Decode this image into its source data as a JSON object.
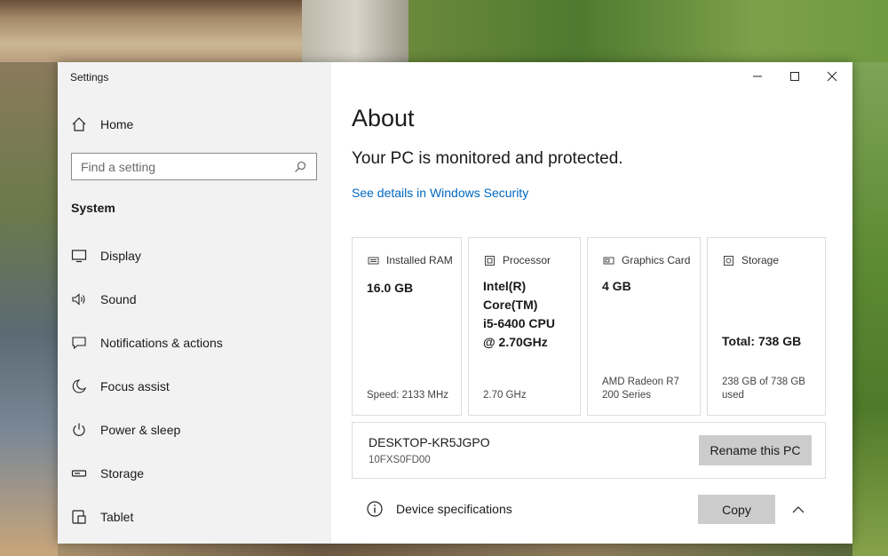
{
  "window": {
    "title": "Settings"
  },
  "sidebar": {
    "home_label": "Home",
    "search_placeholder": "Find a setting",
    "section_title": "System",
    "items": [
      {
        "label": "Display",
        "icon": "monitor-icon"
      },
      {
        "label": "Sound",
        "icon": "speaker-icon"
      },
      {
        "label": "Notifications & actions",
        "icon": "notification-icon"
      },
      {
        "label": "Focus assist",
        "icon": "moon-icon"
      },
      {
        "label": "Power & sleep",
        "icon": "power-icon"
      },
      {
        "label": "Storage",
        "icon": "drive-icon"
      },
      {
        "label": "Tablet",
        "icon": "tablet-icon"
      }
    ]
  },
  "main": {
    "page_title": "About",
    "status_text": "Your PC is monitored and protected.",
    "security_link": "See details in Windows Security",
    "cards": [
      {
        "label": "Installed RAM",
        "icon": "ram-icon",
        "value": "16.0 GB",
        "sub": "Speed: 2133 MHz"
      },
      {
        "label": "Processor",
        "icon": "cpu-icon",
        "value_lines": [
          "Intel(R)",
          "Core(TM)",
          "i5-6400 CPU",
          "@ 2.70GHz"
        ],
        "sub": "2.70 GHz"
      },
      {
        "label": "Graphics Card",
        "icon": "gpu-icon",
        "value": "4 GB",
        "sub_lines": [
          "AMD Radeon R7",
          "200 Series"
        ]
      },
      {
        "label": "Storage",
        "icon": "storage-icon",
        "value": "Total: 738 GB",
        "sub_lines": [
          "238 GB of 738 GB",
          "used"
        ]
      }
    ],
    "pc": {
      "name": "DESKTOP-KR5JGPO",
      "id": "10FXS0FD00",
      "rename_label": "Rename this PC"
    },
    "specs": {
      "label": "Device specifications",
      "copy_label": "Copy"
    }
  },
  "colors": {
    "sidebar_bg": "#f2f2f2",
    "link": "#0067c0",
    "button_bg": "#cccccc"
  }
}
